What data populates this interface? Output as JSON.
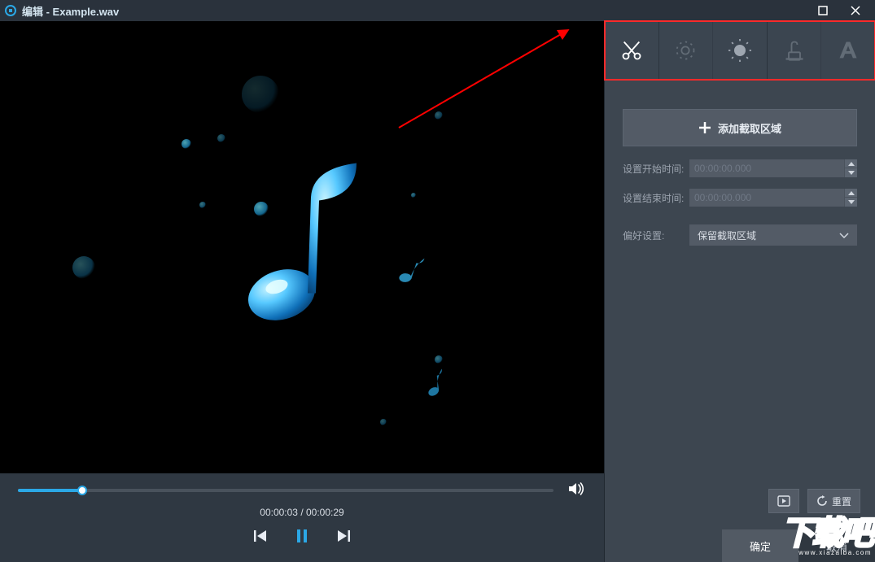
{
  "window": {
    "title": "编辑 - Example.wav"
  },
  "player": {
    "current_time": "00:00:03",
    "total_time": "00:00:29",
    "progress_pct": 12
  },
  "tabs": {
    "cut": "cut",
    "adjust": "adjust",
    "effect": "effect",
    "watermark": "watermark",
    "text": "text"
  },
  "sidebar": {
    "add_region": "添加截取区域",
    "start_label": "设置开始时间:",
    "start_value": "00:00:00.000",
    "end_label": "设置结束时间:",
    "end_value": "00:00:00.000",
    "pref_label": "偏好设置:",
    "pref_value": "保留截取区域"
  },
  "buttons": {
    "reset": "重置",
    "ok": "确定",
    "cancel": "取消"
  },
  "watermark": {
    "text": "下载吧",
    "url": "www.xiazaiba.com"
  }
}
